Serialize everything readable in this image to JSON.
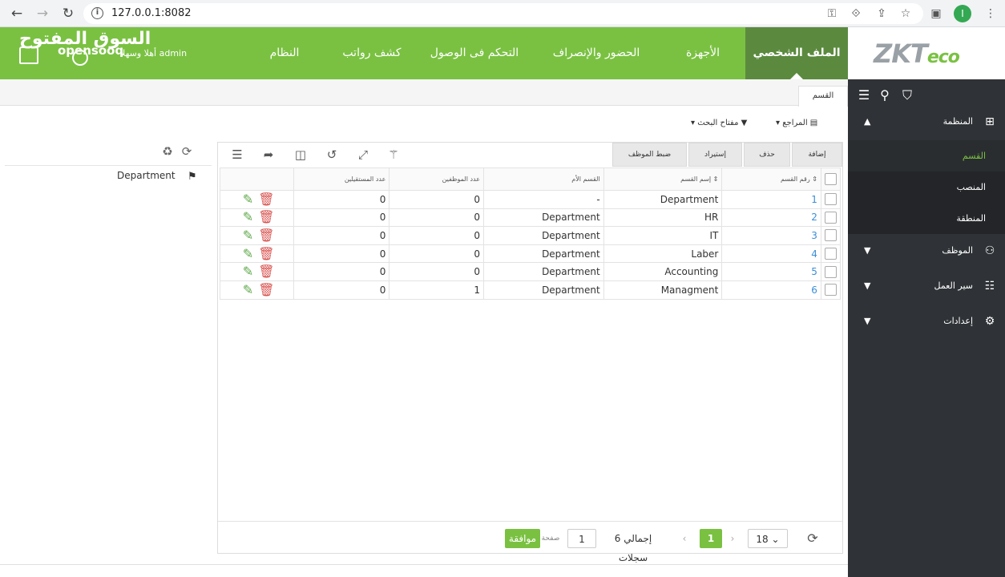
{
  "browser": {
    "url": "127.0.0.1:8082"
  },
  "header": {
    "logo_main": "ZKT",
    "logo_accent": "eco",
    "menu": [
      {
        "label": "الملف الشخصي"
      },
      {
        "label": "الأجهزة"
      },
      {
        "label": "الحضور والإنصراف"
      },
      {
        "label": "التحكم فى الوصول"
      },
      {
        "label": "كشف رواتب"
      },
      {
        "label": "النظام"
      }
    ],
    "welcome": "أهلا وسهلا admin",
    "watermark_ar": "السوق المفتوح",
    "watermark_en": "opensooq"
  },
  "sidebar": {
    "groups": [
      {
        "label": "المنظمة",
        "icon": "org-chart-icon"
      },
      {
        "label": "الموظف",
        "icon": "users-icon"
      },
      {
        "label": "سير العمل",
        "icon": "list-icon"
      },
      {
        "label": "إعدادات",
        "icon": "gears-icon"
      }
    ],
    "subitems": [
      {
        "label": "القسم"
      },
      {
        "label": "المنصب"
      },
      {
        "label": "المنطقة"
      }
    ]
  },
  "tab": {
    "label": "القسم"
  },
  "filters": {
    "references": "المراجع",
    "search_key": "مفتاح البحث"
  },
  "tree": {
    "root": "Department"
  },
  "toolbar": {
    "add": "إضافة",
    "delete": "حذف",
    "import": "إستيراد",
    "set_employee": "ضبط الموظف"
  },
  "table": {
    "headers": {
      "id": "رقم القسم",
      "name": "إسم القسم",
      "parent": "القسم الأم",
      "employees": "عدد الموظفين",
      "resigned": "عدد المستقيلين"
    },
    "rows": [
      {
        "id": "1",
        "name": "Department",
        "parent": "-",
        "employees": "0",
        "resigned": "0"
      },
      {
        "id": "2",
        "name": "HR",
        "parent": "Department",
        "employees": "0",
        "resigned": "0"
      },
      {
        "id": "3",
        "name": "IT",
        "parent": "Department",
        "employees": "0",
        "resigned": "0"
      },
      {
        "id": "4",
        "name": "Laber",
        "parent": "Department",
        "employees": "0",
        "resigned": "0"
      },
      {
        "id": "5",
        "name": "Accounting",
        "parent": "Department",
        "employees": "0",
        "resigned": "0"
      },
      {
        "id": "6",
        "name": "Managment",
        "parent": "Department",
        "employees": "1",
        "resigned": "0"
      }
    ]
  },
  "pager": {
    "page_size": "18",
    "current": "1",
    "total": "إجمالي 6 سجلات",
    "page_input": "1",
    "page_label": "صفحة",
    "go": "موافقة"
  }
}
